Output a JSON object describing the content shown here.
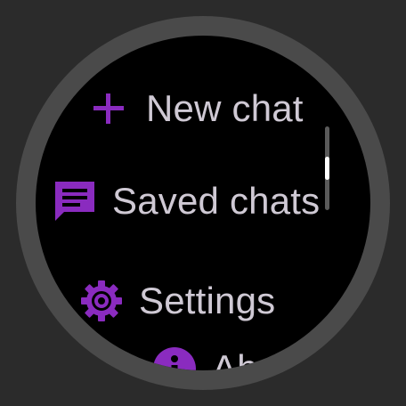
{
  "colors": {
    "accent": "#8a2bbf",
    "label_text": "#cfc9d4",
    "screen_bg": "#000000",
    "bezel": "#4a4a4a",
    "scroll_track": "#5a5a5a",
    "scroll_thumb": "#ffffff"
  },
  "menu": {
    "items": [
      {
        "label": "New chat",
        "icon": "plus-icon"
      },
      {
        "label": "Saved chats",
        "icon": "chat-bubble-icon"
      },
      {
        "label": "Settings",
        "icon": "gear-icon"
      },
      {
        "label": "Ab",
        "icon": "info-icon"
      }
    ]
  },
  "scrollbar": {
    "position_fraction": 0.5
  }
}
